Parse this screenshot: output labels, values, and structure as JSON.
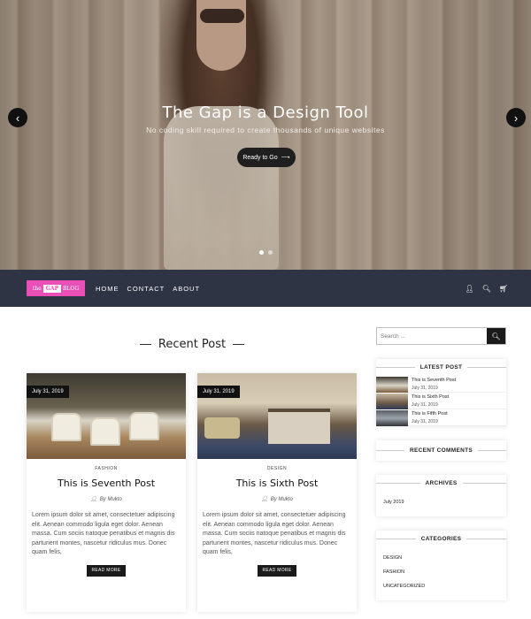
{
  "hero": {
    "title": "The Gap is a Design Tool",
    "subtitle": "No coding skill required to create thousands of unique websites",
    "button_label": "Ready to Go",
    "prev_arrow": "‹",
    "next_arrow": "›",
    "slide_count": 2,
    "active_slide": 1
  },
  "nav": {
    "logo": {
      "the": "the",
      "gap": "GAP",
      "blog": "BLOG"
    },
    "links": [
      "HOME",
      "CONTACT",
      "ABOUT"
    ],
    "icons": [
      "user-icon",
      "search-icon",
      "cart-icon"
    ],
    "bar_color": "#2e3444",
    "logo_color": "#ea4fb8"
  },
  "main": {
    "section_title": "Recent Post",
    "posts": [
      {
        "date": "July 31, 2019",
        "category": "FASHION",
        "title": "This is Seventh Post",
        "author": "By Mukto",
        "excerpt": "Lorem ipsum dolor sit amet, consectetuer adipiscing elit. Aenean commodo ligula eget dolor. Aenean massa. Cum sociis natoque penatibus et magnis dis parturient montes, nascetur ridiculus mus. Donec quam felis,",
        "read_more": "READ MORE"
      },
      {
        "date": "July 31, 2019",
        "category": "DESIGN",
        "title": "This is Sixth Post",
        "author": "By Mukto",
        "excerpt": "Lorem ipsum dolor sit amet, consectetuer adipiscing elit. Aenean commodo ligula eget dolor. Aenean massa. Cum sociis natoque penatibus et magnis dis parturient montes, nascetur ridiculus mus. Donec quam felis,",
        "read_more": "READ MORE"
      }
    ]
  },
  "sidebar": {
    "search_placeholder": "Search ...",
    "latest_post": {
      "title": "LATEST POST",
      "items": [
        {
          "title": "This is Seventh Post",
          "date": "July 31, 2019"
        },
        {
          "title": "This is Sixth Post",
          "date": "July 31, 2019"
        },
        {
          "title": "This is Fifth Post",
          "date": "July 31, 2019"
        }
      ]
    },
    "recent_comments": {
      "title": "RECENT COMMENTS"
    },
    "archives": {
      "title": "ARCHIVES",
      "items": [
        "July 2019"
      ]
    },
    "categories": {
      "title": "CATEGORIES",
      "items": [
        "DESIGN",
        "FASHION",
        "UNCATEGORIZED"
      ]
    }
  }
}
